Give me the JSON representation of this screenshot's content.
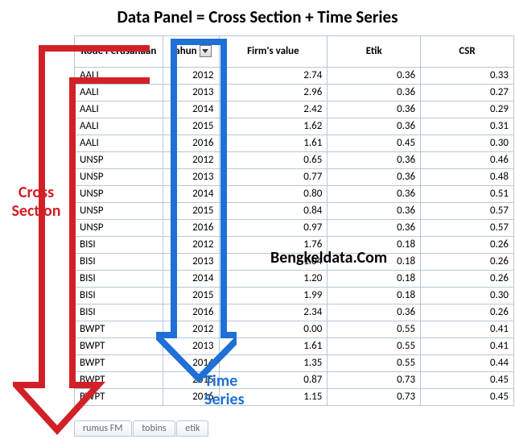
{
  "title": "Data Panel = Cross Section + Time Series",
  "labels": {
    "cross": "Cross",
    "section": "Section",
    "time": "Time",
    "series": "Series"
  },
  "watermark": "Bengkeldata.Com",
  "columns": [
    "Kode Perusahaan",
    "Tahun",
    "Firm's value",
    "Etik",
    "CSR"
  ],
  "rows": [
    {
      "code": "AALI",
      "year": "2012",
      "fv": "2.74",
      "etik": "0.36",
      "csr": "0.33"
    },
    {
      "code": "AALI",
      "year": "2013",
      "fv": "2.96",
      "etik": "0.36",
      "csr": "0.27"
    },
    {
      "code": "AALI",
      "year": "2014",
      "fv": "2.42",
      "etik": "0.36",
      "csr": "0.29"
    },
    {
      "code": "AALI",
      "year": "2015",
      "fv": "1.62",
      "etik": "0.36",
      "csr": "0.31"
    },
    {
      "code": "AALI",
      "year": "2016",
      "fv": "1.61",
      "etik": "0.45",
      "csr": "0.30"
    },
    {
      "code": "UNSP",
      "year": "2012",
      "fv": "0.65",
      "etik": "0.36",
      "csr": "0.46"
    },
    {
      "code": "UNSP",
      "year": "2013",
      "fv": "0.77",
      "etik": "0.36",
      "csr": "0.48"
    },
    {
      "code": "UNSP",
      "year": "2014",
      "fv": "0.80",
      "etik": "0.36",
      "csr": "0.51"
    },
    {
      "code": "UNSP",
      "year": "2015",
      "fv": "0.84",
      "etik": "0.36",
      "csr": "0.57"
    },
    {
      "code": "UNSP",
      "year": "2016",
      "fv": "0.97",
      "etik": "0.36",
      "csr": "0.57"
    },
    {
      "code": "BISI",
      "year": "2012",
      "fv": "1.76",
      "etik": "0.18",
      "csr": "0.26"
    },
    {
      "code": "BISI",
      "year": "2013",
      "fv": "1.04",
      "etik": "0.18",
      "csr": "0.26"
    },
    {
      "code": "BISI",
      "year": "2014",
      "fv": "1.20",
      "etik": "0.18",
      "csr": "0.26"
    },
    {
      "code": "BISI",
      "year": "2015",
      "fv": "1.99",
      "etik": "0.18",
      "csr": "0.30"
    },
    {
      "code": "BISI",
      "year": "2016",
      "fv": "2.34",
      "etik": "0.36",
      "csr": "0.26"
    },
    {
      "code": "BWPT",
      "year": "2012",
      "fv": "0.00",
      "etik": "0.55",
      "csr": "0.41"
    },
    {
      "code": "BWPT",
      "year": "2013",
      "fv": "1.61",
      "etik": "0.55",
      "csr": "0.41"
    },
    {
      "code": "BWPT",
      "year": "2014",
      "fv": "1.35",
      "etik": "0.55",
      "csr": "0.44"
    },
    {
      "code": "BWPT",
      "year": "2015",
      "fv": "0.87",
      "etik": "0.73",
      "csr": "0.45"
    },
    {
      "code": "BWPT",
      "year": "2016",
      "fv": "1.15",
      "etik": "0.73",
      "csr": "0.45"
    }
  ],
  "tabs": [
    "rumus FM",
    "tobins",
    "etik"
  ]
}
